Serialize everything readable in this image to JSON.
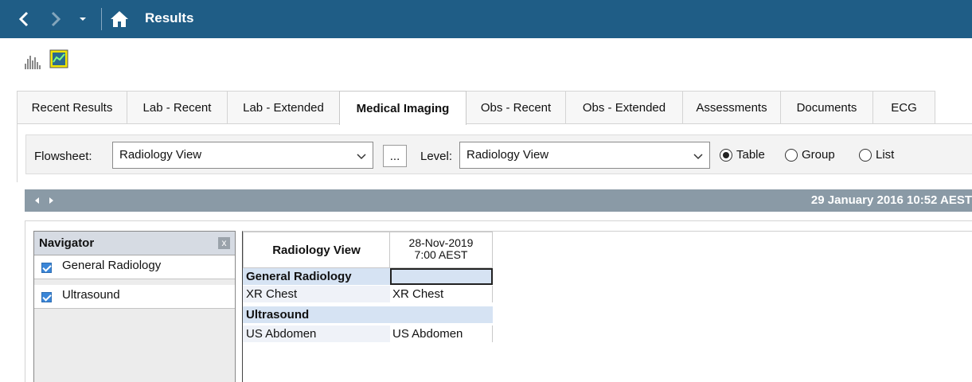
{
  "titlebar": {
    "title": "Results",
    "icons": [
      "back-arrow-icon",
      "forward-arrow-icon",
      "dropdown-caret-icon",
      "home-icon"
    ]
  },
  "toolbar": {
    "icons": [
      "bar-chart-icon",
      "yellow-graph-icon"
    ]
  },
  "tabs": [
    {
      "label": "Recent Results",
      "active": false
    },
    {
      "label": "Lab - Recent",
      "active": false
    },
    {
      "label": "Lab - Extended",
      "active": false
    },
    {
      "label": "Medical Imaging",
      "active": true
    },
    {
      "label": "Obs - Recent",
      "active": false
    },
    {
      "label": "Obs - Extended",
      "active": false
    },
    {
      "label": "Assessments",
      "active": false
    },
    {
      "label": "Documents",
      "active": false
    },
    {
      "label": "ECG",
      "active": false
    }
  ],
  "flowsheet": {
    "flowsheet_label": "Flowsheet:",
    "flowsheet_value": "Radiology View",
    "ellipsis_label": "...",
    "level_label": "Level:",
    "level_value": "Radiology View",
    "radios": [
      {
        "label": "Table",
        "checked": true
      },
      {
        "label": "Group",
        "checked": false
      },
      {
        "label": "List",
        "checked": false
      }
    ]
  },
  "datebar": {
    "date": "29 January 2016 10:52 AEST"
  },
  "navigator": {
    "title": "Navigator",
    "close_label": "x",
    "items": [
      {
        "label": "General Radiology",
        "checked": true
      },
      {
        "label": "Ultrasound",
        "checked": true
      }
    ]
  },
  "grid": {
    "header_left": "Radiology View",
    "header_date": "28-Nov-2019",
    "header_time": "7:00 AEST",
    "rows": [
      {
        "type": "section",
        "name": "General Radiology",
        "value": ""
      },
      {
        "type": "item",
        "name": "XR Chest",
        "value": "XR Chest"
      },
      {
        "type": "section",
        "name": "Ultrasound",
        "value": ""
      },
      {
        "type": "item",
        "name": "US Abdomen",
        "value": "US Abdomen"
      }
    ]
  },
  "colors": {
    "titlebar_bg": "#1f5d86",
    "datebar_bg": "#8a9aa6",
    "section_bg": "#d6e3f3",
    "checkbox": "#3a86d8"
  }
}
